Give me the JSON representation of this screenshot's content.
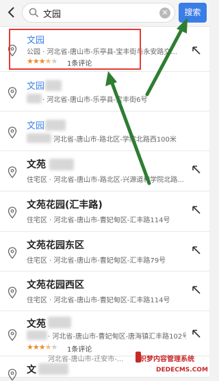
{
  "search": {
    "value": "文园",
    "button_label": "搜索"
  },
  "results": [
    {
      "title": "文园",
      "address": "公园 · 河北省-唐山市-乐亭县-宝丰街与永安路交...",
      "rating_stars": 3.5,
      "review_label": "1条评论"
    },
    {
      "title": "文园",
      "address": "· 河北省-唐山市-乐亭县-宝丰街6号"
    },
    {
      "title": "文园",
      "address": "河北省-唐山市-路北区-学院北路西100米"
    },
    {
      "title": "文苑",
      "address": "住宅区 · 河北省-唐山市-路北区-兴源道和学院北路..."
    },
    {
      "title": "文苑花园(汇丰路)",
      "address": "住宅区 · 河北省-唐山市-曹妃甸区-汇丰路114号"
    },
    {
      "title": "文苑花园东区",
      "address": "住宅区 · 河北省-唐山市-曹妃甸区-汇丰路79号"
    },
    {
      "title": "文苑花园西区",
      "address": "住宅区 · 河北省-唐山市-曹妃甸区-汇丰路114号"
    },
    {
      "title": "文苑",
      "address": "· 河北省-唐山市-曹妃甸区-唐海镇汇丰路102号",
      "rating_stars": 3.5,
      "review_label": "1条评论"
    },
    {
      "title": "文",
      "address": "河北省-唐山市-迁安市-..."
    }
  ],
  "watermark": {
    "text": "织梦内容管理系统",
    "subtext": "DEDECMS.COM"
  },
  "colors": {
    "accent": "#3a7de6",
    "link": "#3b82e6",
    "highlight": "#e53935",
    "annotation_arrow": "#2e7d32",
    "star": "#f08a24"
  },
  "icons": {
    "back": "chevron-left-icon",
    "search": "search-icon",
    "clear": "clear-icon",
    "pin": "map-pin-icon",
    "go": "arrow-up-left-icon"
  }
}
